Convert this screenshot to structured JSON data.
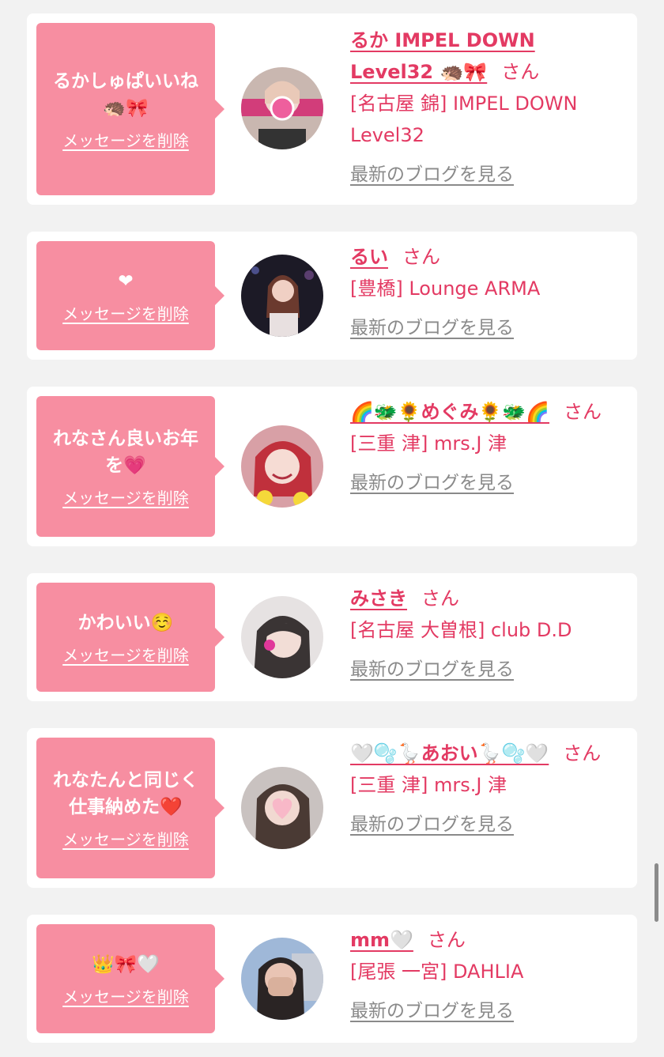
{
  "colors": {
    "bubble": "#f78ea1",
    "accent": "#e33a63",
    "link_gray": "#8a8a8a",
    "background": "#f2f2f2"
  },
  "delete_label": "メッセージを削除",
  "blog_label": "最新のブログを見る",
  "san_label": "さん",
  "cards": [
    {
      "message": "るかしゅぱいいね\n🦔🎀",
      "name": "るか IMPEL DOWN Level32 🦔🎀",
      "shop": "[名古屋 錦] IMPEL DOWN Level32",
      "avatar": "avatar-photo"
    },
    {
      "message": "❤",
      "name": "るい",
      "shop": "[豊橋] Lounge ARMA",
      "avatar": "avatar-photo"
    },
    {
      "message": "れなさん良いお年\nを💗",
      "name": "🌈🐲🌻めぐみ🌻🐲🌈",
      "shop": "[三重 津] mrs.J 津",
      "avatar": "avatar-photo"
    },
    {
      "message": "かわいい☺️",
      "name": "みさき",
      "shop": "[名古屋 大曽根] club D.D",
      "avatar": "avatar-photo"
    },
    {
      "message": "れなたんと同じく\n仕事納めた❤️",
      "name": "🤍🫧🪿あおい🪿🫧🤍",
      "shop": "[三重 津] mrs.J 津",
      "avatar": "avatar-photo"
    },
    {
      "message": "👑🎀🤍",
      "name": "mm🤍",
      "shop": "[尾張 一宮] DAHLIA",
      "avatar": "avatar-photo"
    }
  ]
}
